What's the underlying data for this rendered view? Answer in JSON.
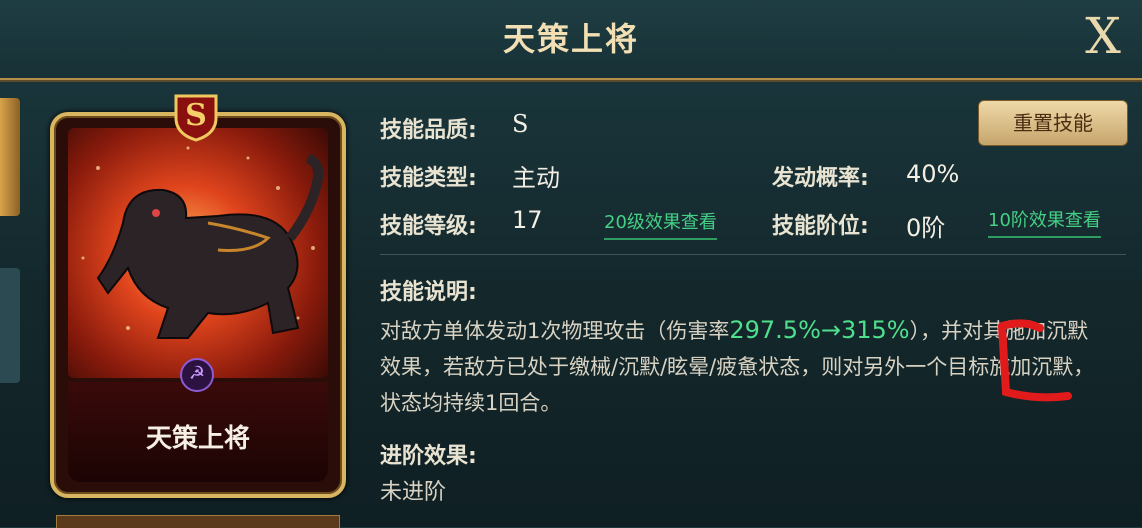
{
  "header": {
    "title": "天策上将",
    "close_label": "X"
  },
  "card": {
    "rank_badge": "S",
    "name": "天策上将",
    "emblem": "☭"
  },
  "skill": {
    "quality_label": "技能品质:",
    "quality_value": "S",
    "type_label": "技能类型:",
    "type_value": "主动",
    "chance_label": "发动概率:",
    "chance_value": "40%",
    "level_label": "技能等级:",
    "level_value": "17",
    "level_link": "20级效果查看",
    "rank_label": "技能阶位:",
    "rank_value": "0阶",
    "rank_link": "10阶效果查看",
    "reset_button": "重置技能",
    "desc_label": "技能说明:",
    "desc_part1": "对敌方单体发动1次物理攻击（伤害率",
    "desc_highlight": "297.5%→315%",
    "desc_part2": "），并对其施加沉默效果，若敌方已处于缴械/沉默/眩晕/疲惫状态，则对另外一个目标施加沉默，状态均持续1回合。",
    "advance_label": "进阶效果:",
    "advance_value": "未进阶"
  },
  "colors": {
    "accent_gold": "#d8b560",
    "highlight_green": "#4fe08e",
    "annotation_red": "#e11b1b"
  }
}
